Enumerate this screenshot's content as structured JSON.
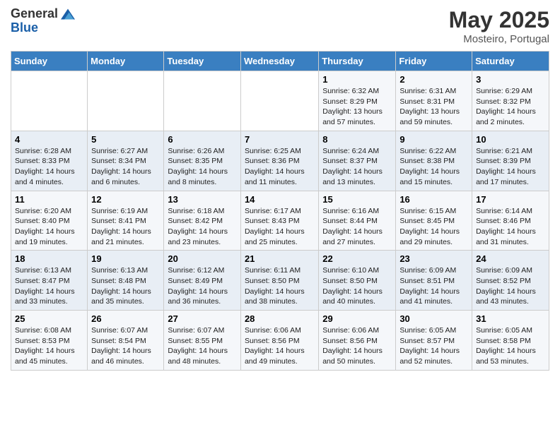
{
  "header": {
    "logo_general": "General",
    "logo_blue": "Blue",
    "month": "May 2025",
    "location": "Mosteiro, Portugal"
  },
  "weekdays": [
    "Sunday",
    "Monday",
    "Tuesday",
    "Wednesday",
    "Thursday",
    "Friday",
    "Saturday"
  ],
  "weeks": [
    [
      {
        "day": "",
        "info": ""
      },
      {
        "day": "",
        "info": ""
      },
      {
        "day": "",
        "info": ""
      },
      {
        "day": "",
        "info": ""
      },
      {
        "day": "1",
        "info": "Sunrise: 6:32 AM\nSunset: 8:29 PM\nDaylight: 13 hours and 57 minutes."
      },
      {
        "day": "2",
        "info": "Sunrise: 6:31 AM\nSunset: 8:31 PM\nDaylight: 13 hours and 59 minutes."
      },
      {
        "day": "3",
        "info": "Sunrise: 6:29 AM\nSunset: 8:32 PM\nDaylight: 14 hours and 2 minutes."
      }
    ],
    [
      {
        "day": "4",
        "info": "Sunrise: 6:28 AM\nSunset: 8:33 PM\nDaylight: 14 hours and 4 minutes."
      },
      {
        "day": "5",
        "info": "Sunrise: 6:27 AM\nSunset: 8:34 PM\nDaylight: 14 hours and 6 minutes."
      },
      {
        "day": "6",
        "info": "Sunrise: 6:26 AM\nSunset: 8:35 PM\nDaylight: 14 hours and 8 minutes."
      },
      {
        "day": "7",
        "info": "Sunrise: 6:25 AM\nSunset: 8:36 PM\nDaylight: 14 hours and 11 minutes."
      },
      {
        "day": "8",
        "info": "Sunrise: 6:24 AM\nSunset: 8:37 PM\nDaylight: 14 hours and 13 minutes."
      },
      {
        "day": "9",
        "info": "Sunrise: 6:22 AM\nSunset: 8:38 PM\nDaylight: 14 hours and 15 minutes."
      },
      {
        "day": "10",
        "info": "Sunrise: 6:21 AM\nSunset: 8:39 PM\nDaylight: 14 hours and 17 minutes."
      }
    ],
    [
      {
        "day": "11",
        "info": "Sunrise: 6:20 AM\nSunset: 8:40 PM\nDaylight: 14 hours and 19 minutes."
      },
      {
        "day": "12",
        "info": "Sunrise: 6:19 AM\nSunset: 8:41 PM\nDaylight: 14 hours and 21 minutes."
      },
      {
        "day": "13",
        "info": "Sunrise: 6:18 AM\nSunset: 8:42 PM\nDaylight: 14 hours and 23 minutes."
      },
      {
        "day": "14",
        "info": "Sunrise: 6:17 AM\nSunset: 8:43 PM\nDaylight: 14 hours and 25 minutes."
      },
      {
        "day": "15",
        "info": "Sunrise: 6:16 AM\nSunset: 8:44 PM\nDaylight: 14 hours and 27 minutes."
      },
      {
        "day": "16",
        "info": "Sunrise: 6:15 AM\nSunset: 8:45 PM\nDaylight: 14 hours and 29 minutes."
      },
      {
        "day": "17",
        "info": "Sunrise: 6:14 AM\nSunset: 8:46 PM\nDaylight: 14 hours and 31 minutes."
      }
    ],
    [
      {
        "day": "18",
        "info": "Sunrise: 6:13 AM\nSunset: 8:47 PM\nDaylight: 14 hours and 33 minutes."
      },
      {
        "day": "19",
        "info": "Sunrise: 6:13 AM\nSunset: 8:48 PM\nDaylight: 14 hours and 35 minutes."
      },
      {
        "day": "20",
        "info": "Sunrise: 6:12 AM\nSunset: 8:49 PM\nDaylight: 14 hours and 36 minutes."
      },
      {
        "day": "21",
        "info": "Sunrise: 6:11 AM\nSunset: 8:50 PM\nDaylight: 14 hours and 38 minutes."
      },
      {
        "day": "22",
        "info": "Sunrise: 6:10 AM\nSunset: 8:50 PM\nDaylight: 14 hours and 40 minutes."
      },
      {
        "day": "23",
        "info": "Sunrise: 6:09 AM\nSunset: 8:51 PM\nDaylight: 14 hours and 41 minutes."
      },
      {
        "day": "24",
        "info": "Sunrise: 6:09 AM\nSunset: 8:52 PM\nDaylight: 14 hours and 43 minutes."
      }
    ],
    [
      {
        "day": "25",
        "info": "Sunrise: 6:08 AM\nSunset: 8:53 PM\nDaylight: 14 hours and 45 minutes."
      },
      {
        "day": "26",
        "info": "Sunrise: 6:07 AM\nSunset: 8:54 PM\nDaylight: 14 hours and 46 minutes."
      },
      {
        "day": "27",
        "info": "Sunrise: 6:07 AM\nSunset: 8:55 PM\nDaylight: 14 hours and 48 minutes."
      },
      {
        "day": "28",
        "info": "Sunrise: 6:06 AM\nSunset: 8:56 PM\nDaylight: 14 hours and 49 minutes."
      },
      {
        "day": "29",
        "info": "Sunrise: 6:06 AM\nSunset: 8:56 PM\nDaylight: 14 hours and 50 minutes."
      },
      {
        "day": "30",
        "info": "Sunrise: 6:05 AM\nSunset: 8:57 PM\nDaylight: 14 hours and 52 minutes."
      },
      {
        "day": "31",
        "info": "Sunrise: 6:05 AM\nSunset: 8:58 PM\nDaylight: 14 hours and 53 minutes."
      }
    ]
  ]
}
